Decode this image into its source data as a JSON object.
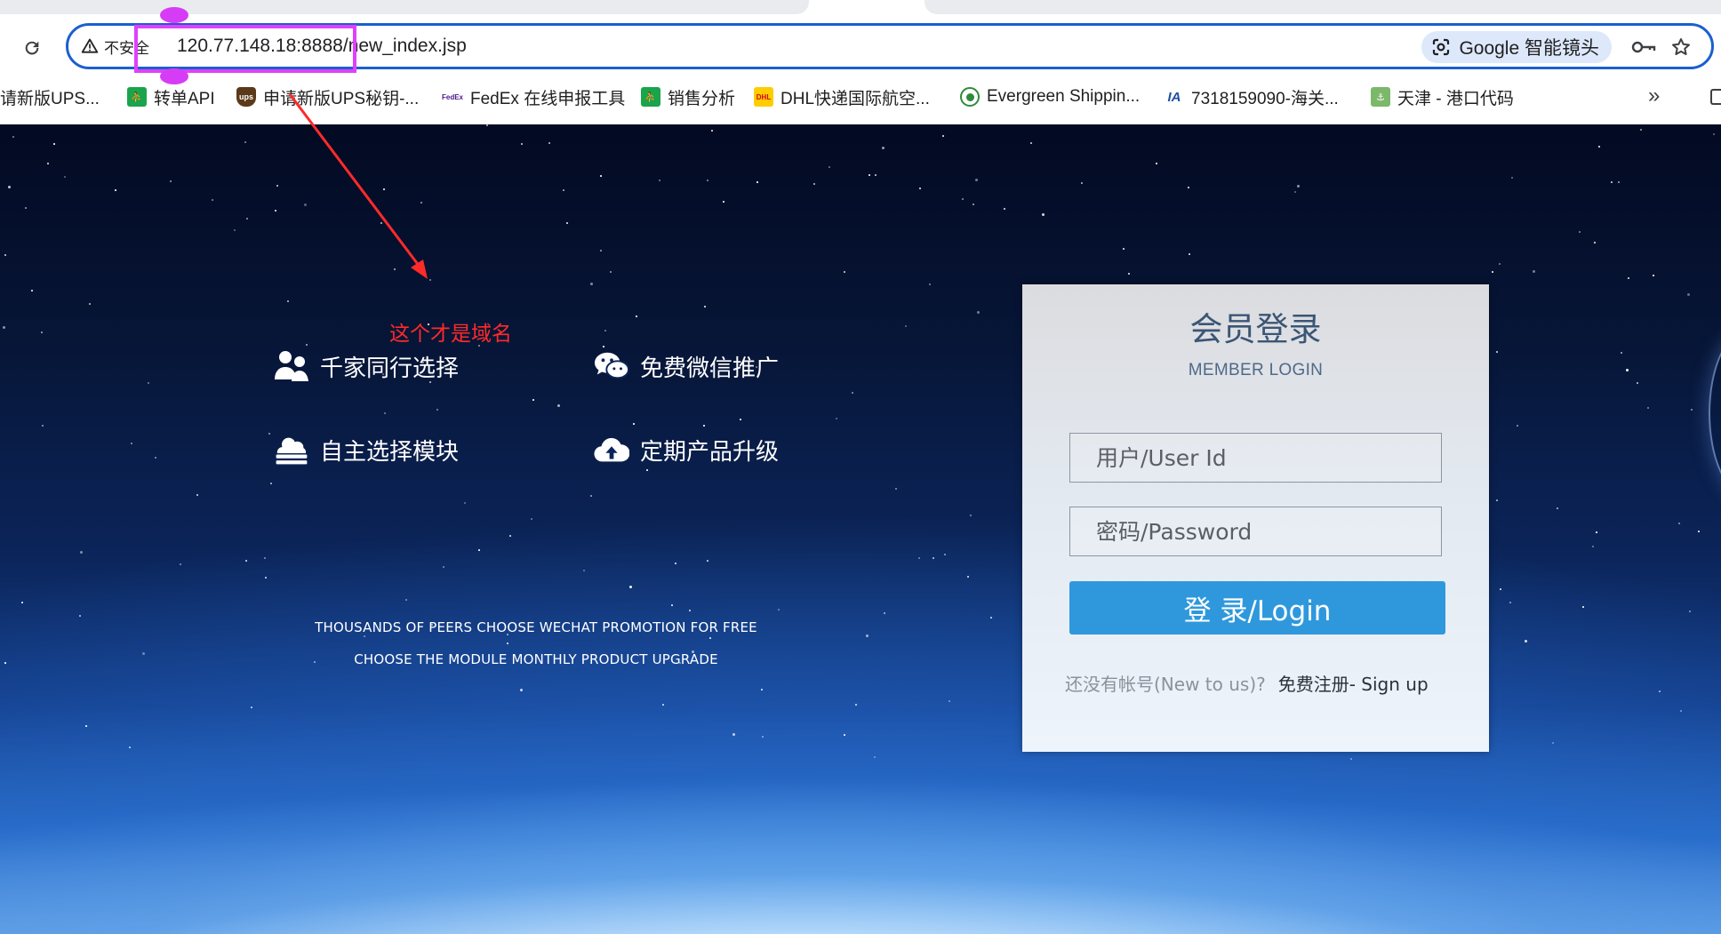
{
  "browser": {
    "security_label": "不安全",
    "url_host": "120.77.148.18:8888",
    "url_path": "/new_index.jsp",
    "lens_label": "Google 智能镜头",
    "icons": [
      "reload-icon",
      "warning-triangle-icon",
      "google-lens-icon",
      "key-icon",
      "star-icon",
      "chevron-double-right-icon"
    ]
  },
  "bookmarks": [
    {
      "label": "请新版UPS...",
      "icon": "none"
    },
    {
      "label": "转单API",
      "icon": "figure-icon",
      "color": "#1aa44b"
    },
    {
      "label": "申请新版UPS秘钥-...",
      "icon": "ups-logo-icon",
      "color": "#5a3a1a"
    },
    {
      "label": "FedEx 在线申报工具",
      "icon": "fedex-logo-icon",
      "color": "#4d148c"
    },
    {
      "label": "销售分析",
      "icon": "figure-icon",
      "color": "#1aa44b"
    },
    {
      "label": "DHL快递国际航空...",
      "icon": "dhl-logo-icon",
      "color": "#ffcc00"
    },
    {
      "label": "Evergreen Shippin...",
      "icon": "evergreen-logo-icon",
      "color": "#2e8b3a"
    },
    {
      "label": "7318159090-海关...",
      "icon": "ia-logo-icon",
      "color": "#1d4fa3"
    },
    {
      "label": "天津 - 港口代码",
      "icon": "port-icon",
      "color": "#7cb86a"
    }
  ],
  "annotation": {
    "text": "这个才是域名",
    "box_color": "#e040fb",
    "arrow_color": "#ff2a2a"
  },
  "features": [
    {
      "label": "千家同行选择",
      "icon": "users-icon"
    },
    {
      "label": "免费微信推广",
      "icon": "wechat-icon"
    },
    {
      "label": "自主选择模块",
      "icon": "cloud-server-icon"
    },
    {
      "label": "定期产品升级",
      "icon": "cloud-upload-icon"
    }
  ],
  "taglines": [
    "THOUSANDS OF PEERS CHOOSE WECHAT PROMOTION FOR FREE",
    "CHOOSE THE MODULE MONTHLY PRODUCT UPGRADE"
  ],
  "login": {
    "title": "会员登录",
    "subtitle": "MEMBER LOGIN",
    "user_placeholder": "用户/User Id",
    "password_placeholder": "密码/Password",
    "button_label": "登 录/Login",
    "signup_question": "还没有帐号(New to us)?",
    "signup_link": "免费注册- Sign up",
    "button_color": "#2f98dc"
  }
}
